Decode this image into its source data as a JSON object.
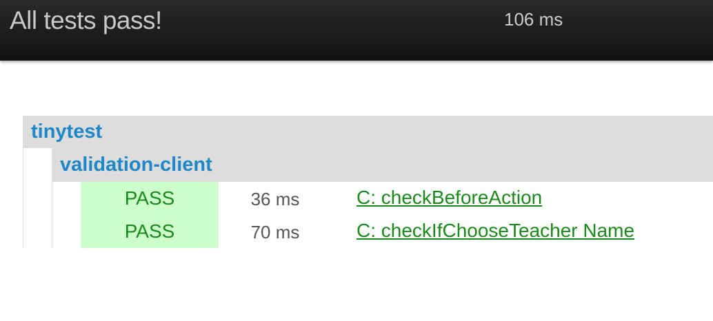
{
  "header": {
    "title": "All tests pass!",
    "total_time": "106 ms"
  },
  "groups": [
    {
      "name": "tinytest",
      "subgroups": [
        {
          "name": "validation-client",
          "tests": [
            {
              "status": "PASS",
              "time": "36 ms",
              "name": "C: checkBeforeAction"
            },
            {
              "status": "PASS",
              "time": "70 ms",
              "name": "C: checkIfChooseTeacher Name"
            }
          ]
        }
      ]
    }
  ],
  "colors": {
    "header_bg": "#1a1a1a",
    "group_bg": "#dddddd",
    "group_name": "#1e87c8",
    "pass_bg": "#ccffcc",
    "pass_text": "#1a8a1a"
  }
}
